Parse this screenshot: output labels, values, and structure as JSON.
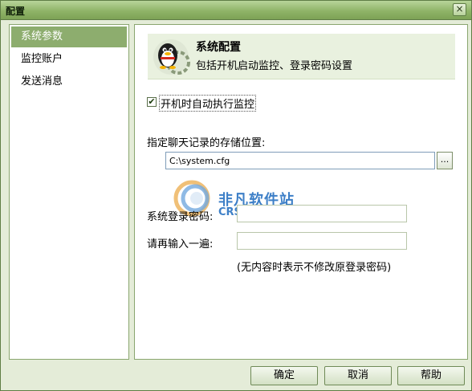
{
  "window": {
    "title": "配置",
    "close_label": "×"
  },
  "sidebar": {
    "items": [
      {
        "label": "系统参数",
        "active": true
      },
      {
        "label": "监控账户",
        "active": false
      },
      {
        "label": "发送消息",
        "active": false
      }
    ]
  },
  "header": {
    "title": "系统配置",
    "subtitle": "包括开机启动监控、登录密码设置"
  },
  "autostart": {
    "label": "开机时自动执行监控",
    "checked": true,
    "check_mark": "✔"
  },
  "storage": {
    "label": "指定聊天记录的存储位置:",
    "path": "C:\\system.cfg",
    "browse_label": "..."
  },
  "password": {
    "label": "系统登录密码:",
    "confirm_label": "请再输入一遍:",
    "value": "",
    "confirm_value": "",
    "hint": "(无内容时表示不修改原登录密码)"
  },
  "watermark": {
    "text_cn": "非凡软件站",
    "text_en": "CRSKY.com"
  },
  "footer": {
    "ok_label": "确定",
    "cancel_label": "取消",
    "help_label": "帮助"
  },
  "colors": {
    "accent": "#8dad6e",
    "frame": "#5f7d45",
    "panel_bg": "#e4ecd8"
  }
}
